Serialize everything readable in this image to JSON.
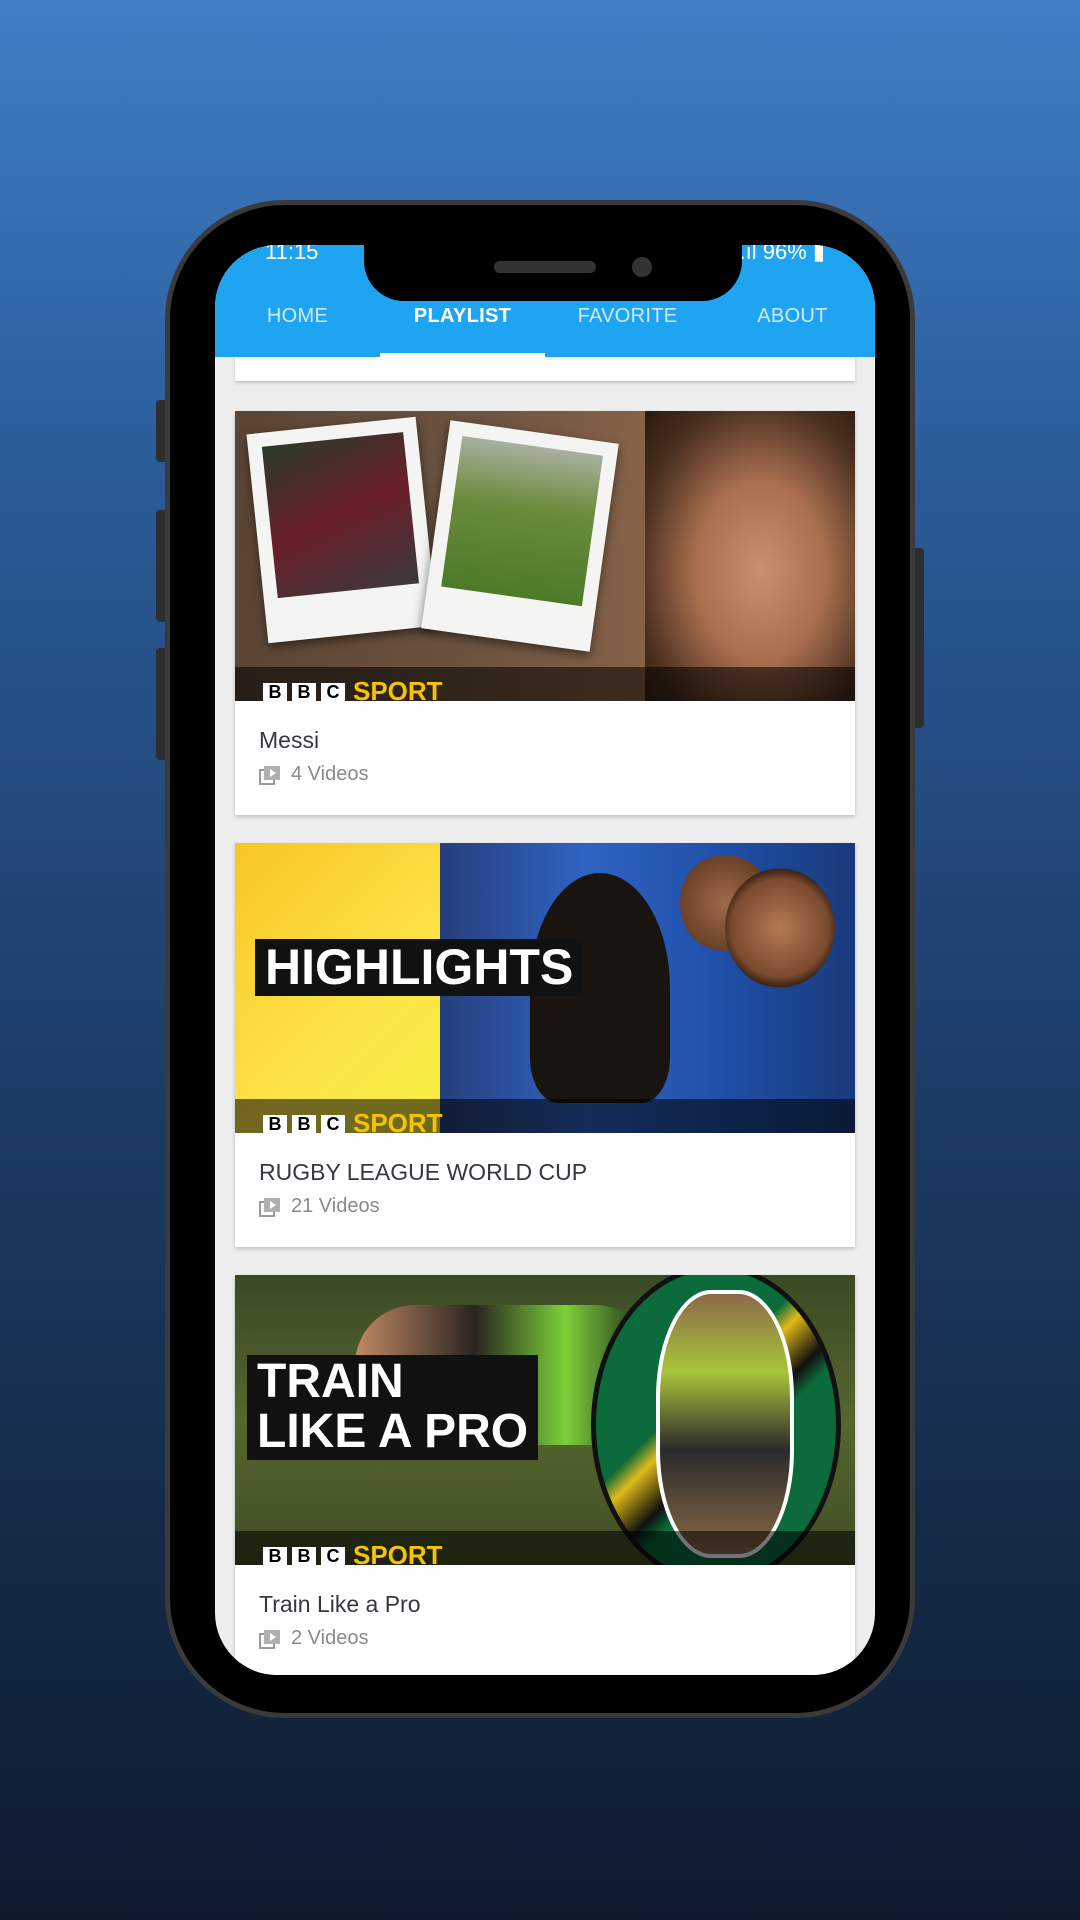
{
  "status_bar": {
    "time": "11:15",
    "battery": "96%"
  },
  "tabs": [
    {
      "label": "HOME",
      "active": false
    },
    {
      "label": "PLAYLIST",
      "active": true
    },
    {
      "label": "FAVORITE",
      "active": false
    },
    {
      "label": "ABOUT",
      "active": false
    }
  ],
  "playlists": [
    {
      "title": "Messi",
      "count": "4 Videos",
      "thumbnail": {
        "brand_blocks": [
          "B",
          "B",
          "C"
        ],
        "brand_word": "SPORT",
        "overlay_text": ""
      }
    },
    {
      "title": "RUGBY LEAGUE WORLD CUP",
      "count": "21 Videos",
      "thumbnail": {
        "brand_blocks": [
          "B",
          "B",
          "C"
        ],
        "brand_word": "SPORT",
        "overlay_text": "HIGHLIGHTS"
      }
    },
    {
      "title": "Train Like a Pro",
      "count": "2 Videos",
      "thumbnail": {
        "brand_blocks": [
          "B",
          "B",
          "C"
        ],
        "brand_word": "SPORT",
        "overlay_line1": "TRAIN",
        "overlay_line2": "LIKE A PRO"
      }
    }
  ],
  "colors": {
    "app_bar": "#1fa4f2",
    "brand_yellow": "#f7c300"
  },
  "icons": {
    "playlist": "video-library-icon"
  }
}
